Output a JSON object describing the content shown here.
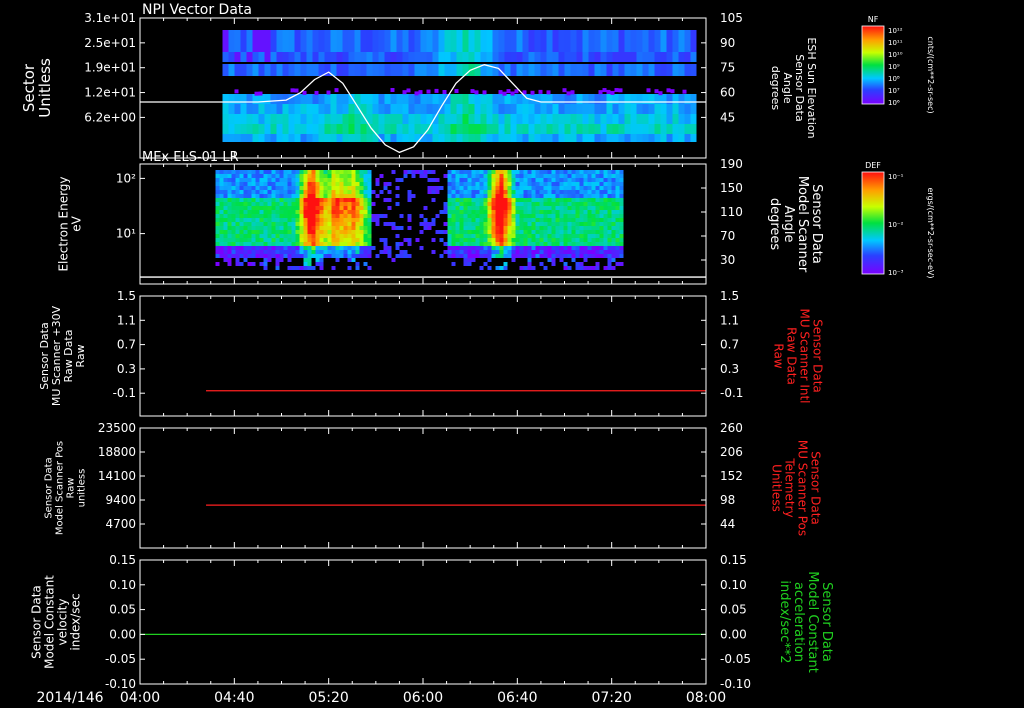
{
  "time_axis": {
    "date_label": "2014/146",
    "ticks": [
      "04:00",
      "04:40",
      "05:20",
      "06:00",
      "06:40",
      "07:20",
      "08:00"
    ]
  },
  "chart_data": [
    {
      "type": "heatmap",
      "title": "NPI Vector Data",
      "ylabel_lines": [
        "Sector",
        "Unitless"
      ],
      "ytick_labels": [
        "3.1e+01",
        "2.5e+01",
        "1.9e+01",
        "1.2e+01",
        "6.2e+00"
      ],
      "right_ylabel_lines": [
        "ESH Sun Elevation",
        "Sensor Data",
        "Angle",
        "degrees"
      ],
      "right_ytick_labels": [
        "105",
        "90",
        "75",
        "60",
        "45"
      ],
      "overlay_line": {
        "name": "ESH Sun Elevation Angle",
        "x": [
          "04:00",
          "04:50",
          "05:02",
          "05:08",
          "05:14",
          "05:20",
          "05:26",
          "05:32",
          "05:38",
          "05:44",
          "05:50",
          "05:56",
          "06:02",
          "06:08",
          "06:14",
          "06:20",
          "06:26",
          "06:32",
          "06:38",
          "06:44",
          "06:50",
          "06:56",
          "07:02",
          "08:00"
        ],
        "y": [
          60,
          60,
          61,
          65,
          72,
          76,
          70,
          58,
          46,
          37,
          33,
          36,
          45,
          58,
          70,
          77,
          80,
          78,
          70,
          62,
          60,
          60,
          60,
          60
        ]
      },
      "colorbar": {
        "label": "NF",
        "units": "cnts/(cm**2-sr-sec)",
        "tick_labels": [
          "10¹²",
          "10¹¹",
          "10¹⁰",
          "10⁹",
          "10⁸",
          "10⁷",
          "10⁶"
        ]
      }
    },
    {
      "type": "heatmap",
      "title": "MEx ELS-01 LR",
      "ylabel_lines": [
        "Electron Energy",
        "eV"
      ],
      "ytick_labels": [
        "10²",
        "10¹"
      ],
      "right_ylabel_lines": [
        "Sensor Data",
        "Model Scanner",
        "Angle",
        "degrees"
      ],
      "right_ytick_labels": [
        "190",
        "150",
        "110",
        "70",
        "30"
      ],
      "overlay_line": {
        "name": "Model Scanner Angle",
        "x": [
          "04:00",
          "08:00"
        ],
        "y": [
          11,
          11
        ]
      },
      "colorbar": {
        "label": "DEF",
        "units": "ergs/(cm**2-sr-sec-eV)",
        "tick_labels": [
          "10⁻¹",
          "10⁻²",
          "10⁻³"
        ]
      }
    },
    {
      "type": "line",
      "ylabel_lines": [
        "Sensor Data",
        "MU Scanner +30V",
        "Raw Data",
        "Raw"
      ],
      "ytick_labels": [
        "1.5",
        "1.1",
        "0.7",
        "0.3",
        "-0.1"
      ],
      "right_ylabel_lines": [
        "Sensor Data",
        "MU Scanner Intl",
        "Raw Data",
        "Raw"
      ],
      "right_ytick_labels": [
        "1.5",
        "1.1",
        "0.7",
        "0.3",
        "-0.1"
      ],
      "ylim": [
        -0.4,
        1.5
      ],
      "series": [
        {
          "x": [
            "04:28",
            "08:00"
          ],
          "y": [
            0,
            0
          ],
          "color": "#ff2020"
        }
      ]
    },
    {
      "type": "line",
      "ylabel_lines": [
        "Sensor Data",
        "Model Scanner Pos",
        "Raw",
        "unitless"
      ],
      "ytick_labels": [
        "23500",
        "18800",
        "14100",
        "9400",
        "4700"
      ],
      "right_ylabel_lines": [
        "Sensor Data",
        "MU Scanner Pos",
        "Telemetry",
        "Unitless"
      ],
      "right_ytick_labels": [
        "260",
        "206",
        "152",
        "98",
        "44"
      ],
      "ylim": [
        0,
        23500
      ],
      "series": [
        {
          "x": [
            "04:28",
            "08:00"
          ],
          "y": [
            8400,
            8400
          ],
          "color": "#ff2020"
        }
      ]
    },
    {
      "type": "line",
      "ylabel_lines": [
        "Sensor Data",
        "Model Constant",
        "velocity",
        "index/sec"
      ],
      "ytick_labels": [
        "0.15",
        "0.10",
        "0.05",
        "0.00",
        "-0.05",
        "-0.10"
      ],
      "right_ylabel_lines": [
        "Sensor Data",
        "Model Constant",
        "acceleration",
        "index/sec**2"
      ],
      "right_ytick_labels": [
        "0.15",
        "0.10",
        "0.05",
        "0.00",
        "-0.05",
        "-0.10"
      ],
      "ylim": [
        -0.1,
        0.15
      ],
      "series": [
        {
          "x": [
            "04:00",
            "08:00"
          ],
          "y": [
            0,
            0
          ],
          "color": "#20d020"
        }
      ]
    }
  ],
  "colors": {
    "red": "#ff2020",
    "green": "#20d020",
    "white": "#ffffff",
    "background": "#000000"
  }
}
